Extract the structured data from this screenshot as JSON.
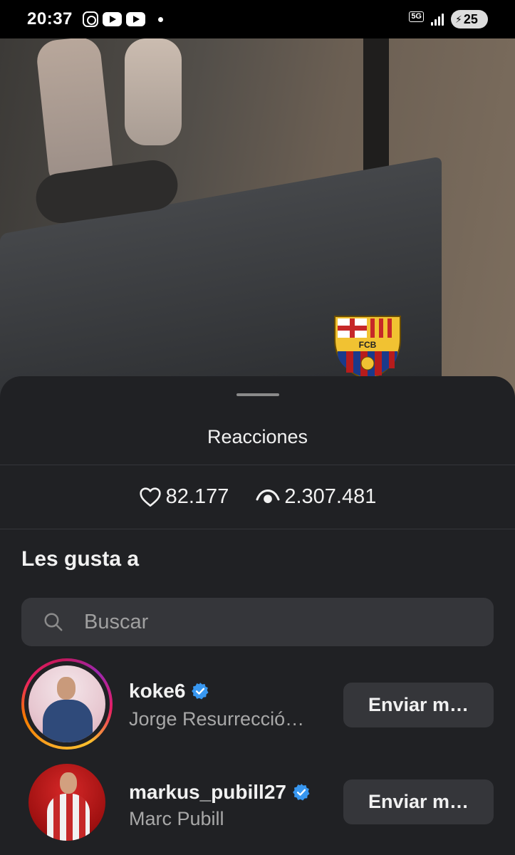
{
  "status_bar": {
    "time": "20:37",
    "network": "5G",
    "battery": "25",
    "icons": [
      "instagram-icon",
      "youtube-icon",
      "youtube-icon",
      "notification-dot-icon",
      "5g-icon",
      "signal-icon",
      "battery-charging-icon"
    ]
  },
  "video": {
    "crest_text": "FCB"
  },
  "sheet": {
    "title": "Reacciones",
    "likes": "82.177",
    "views": "2.307.481",
    "section_title": "Les gusta a",
    "search_placeholder": "Buscar",
    "users": [
      {
        "username": "koke6",
        "full_name": "Jorge Resurrecció…",
        "verified": true,
        "button": "Enviar m…"
      },
      {
        "username": "markus_pubill27",
        "full_name": "Marc Pubill",
        "verified": true,
        "button": "Enviar m…"
      }
    ]
  },
  "colors": {
    "sheet_background": "#202124",
    "input_background": "#35363a",
    "verified_blue": "#3897f0",
    "secondary_text": "#a8a8a8"
  }
}
